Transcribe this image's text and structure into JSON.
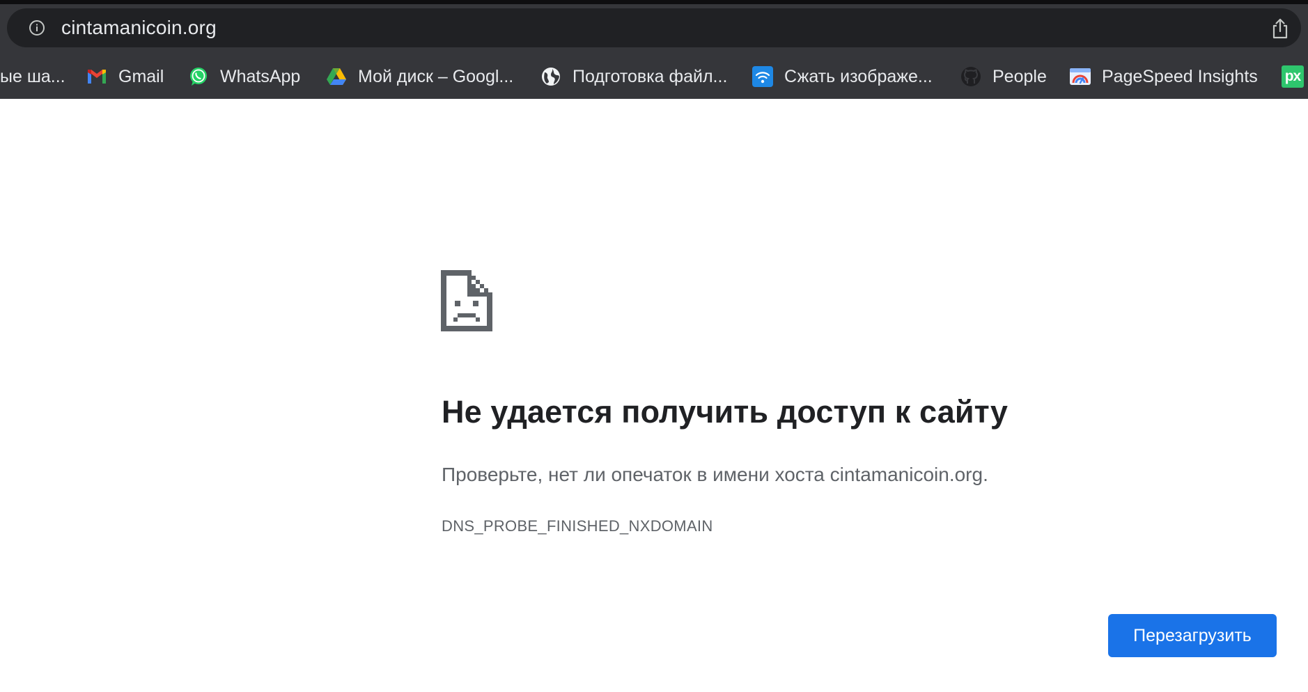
{
  "browser": {
    "url": "cintamanicoin.org",
    "bookmarks": [
      {
        "label": "ые ша...",
        "icon": "none"
      },
      {
        "label": "Gmail",
        "icon": "gmail-icon"
      },
      {
        "label": "WhatsApp",
        "icon": "whatsapp-icon"
      },
      {
        "label": "Мой диск – Googl...",
        "icon": "google-drive-icon"
      },
      {
        "label": "Подготовка файл...",
        "icon": "globe-icon"
      },
      {
        "label": "Сжать изображе...",
        "icon": "wifi-icon"
      },
      {
        "label": "People",
        "icon": "github-icon"
      },
      {
        "label": "PageSpeed Insights",
        "icon": "pagespeed-icon"
      },
      {
        "label": "px",
        "icon": "pixabay-icon"
      }
    ]
  },
  "error": {
    "icon": "sad-page-icon",
    "title": "Не удается получить доступ к сайту",
    "description": "Проверьте, нет ли опечаток в имени хоста cintamanicoin.org.",
    "code": "DNS_PROBE_FINISHED_NXDOMAIN",
    "reload_label": "Перезагрузить"
  },
  "colors": {
    "toolbar_bg": "#35363a",
    "omnibox_bg": "#202124",
    "title": "#202124",
    "text_secondary": "#5f6368",
    "button_blue": "#1a73e8"
  }
}
